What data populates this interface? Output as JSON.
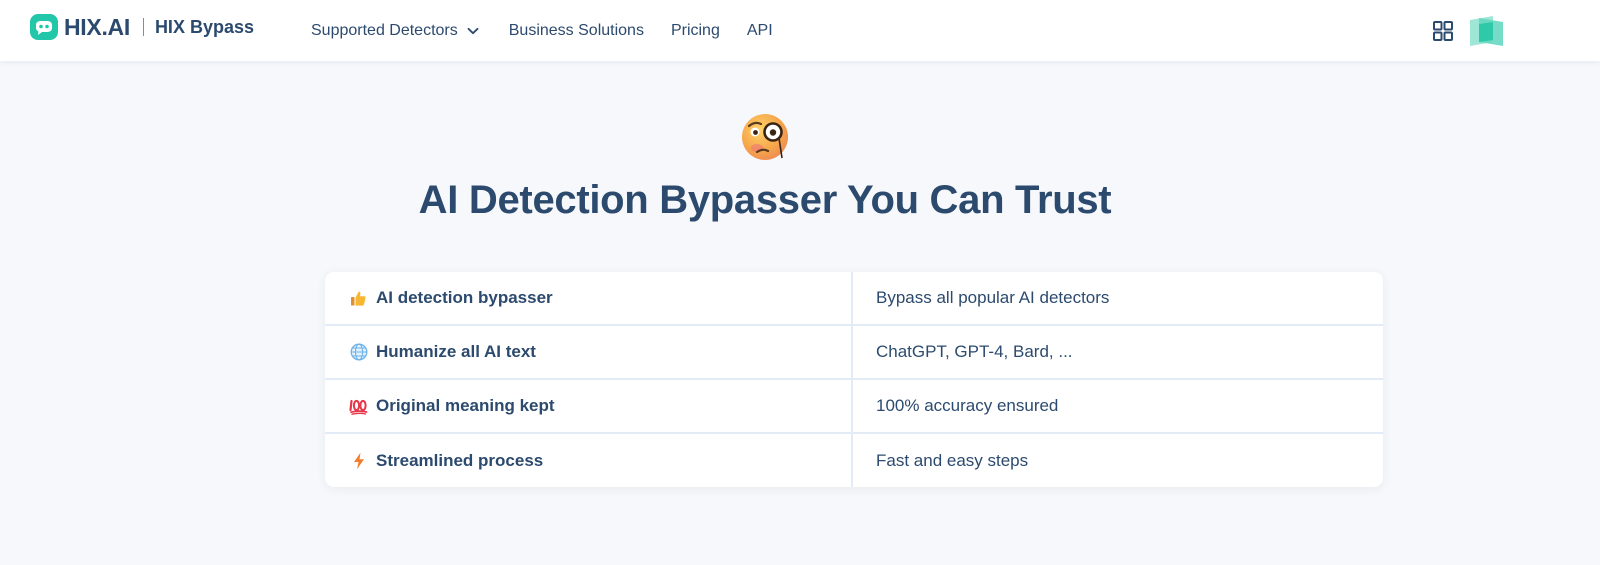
{
  "header": {
    "logo_text": "HIX.AI",
    "product_name": "HIX Bypass",
    "nav": {
      "supported_detectors": "Supported Detectors",
      "business_solutions": "Business Solutions",
      "pricing": "Pricing",
      "api": "API"
    },
    "icons": [
      "logo-icon",
      "chevron-down-icon",
      "apps-grid-icon",
      "account-avatar-icon"
    ]
  },
  "hero": {
    "emoji": "face-with-monocle",
    "title": "AI Detection Bypasser You Can Trust"
  },
  "features": [
    {
      "icon": "thumbs-up",
      "label": "AI detection bypasser",
      "value": "Bypass all popular AI detectors"
    },
    {
      "icon": "globe",
      "label": "Humanize all AI text",
      "value": "ChatGPT, GPT-4, Bard, ..."
    },
    {
      "icon": "hundred-points",
      "label": "Original meaning kept",
      "value": "100% accuracy ensured"
    },
    {
      "icon": "lightning",
      "label": "Streamlined process",
      "value": "Fast and easy steps"
    }
  ],
  "colors": {
    "brand_teal": "#22c7a9",
    "text_navy": "#2c4a6e",
    "page_bg": "#f7f8fc",
    "divider": "#e3ebf6"
  }
}
